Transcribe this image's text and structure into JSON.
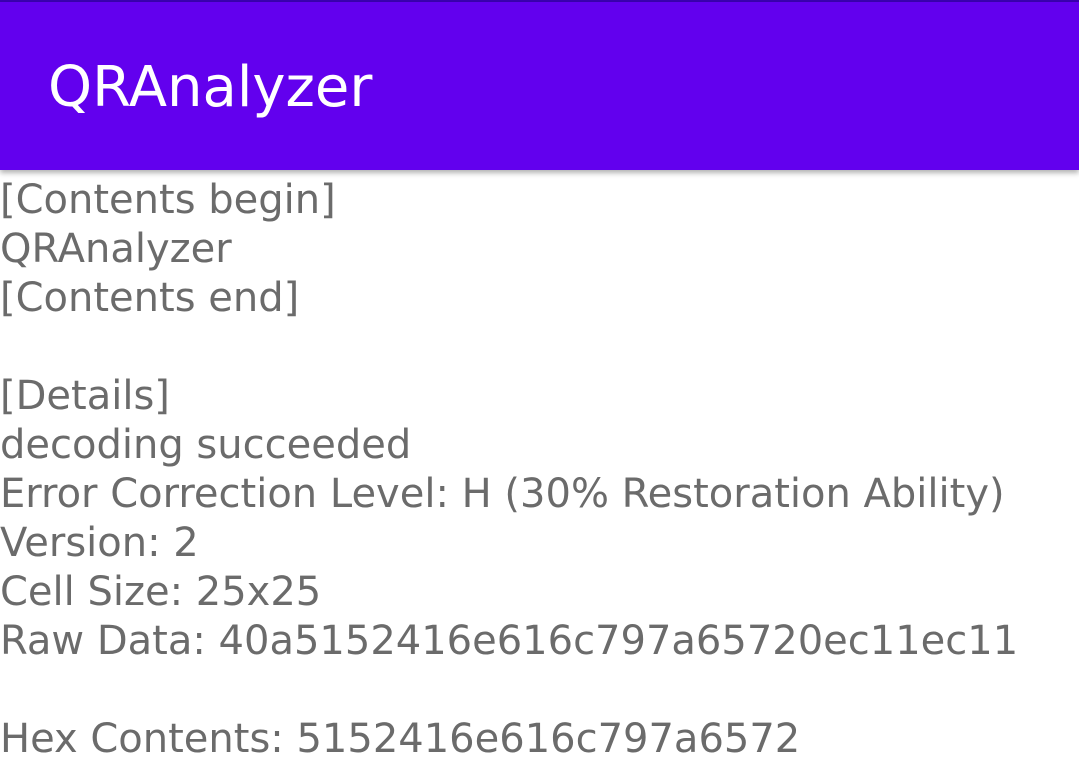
{
  "app_bar": {
    "title": "QRAnalyzer",
    "background_color": "#6200ee",
    "title_color": "#ffffff"
  },
  "result": {
    "contents_begin": "[Contents begin]",
    "contents": "QRAnalyzer",
    "contents_end": "[Contents end]",
    "details_header": "[Details]",
    "status": "decoding succeeded",
    "error_correction": "Error Correction Level: H (30% Restoration Ability)",
    "version": "Version: 2",
    "cell_size": "Cell Size: 25x25",
    "raw_data": "Raw Data: 40a5152416e616c797a65720ec11ec11",
    "hex_contents": "Hex Contents: 5152416e616c797a6572",
    "text_color": "#6b6b6b"
  }
}
